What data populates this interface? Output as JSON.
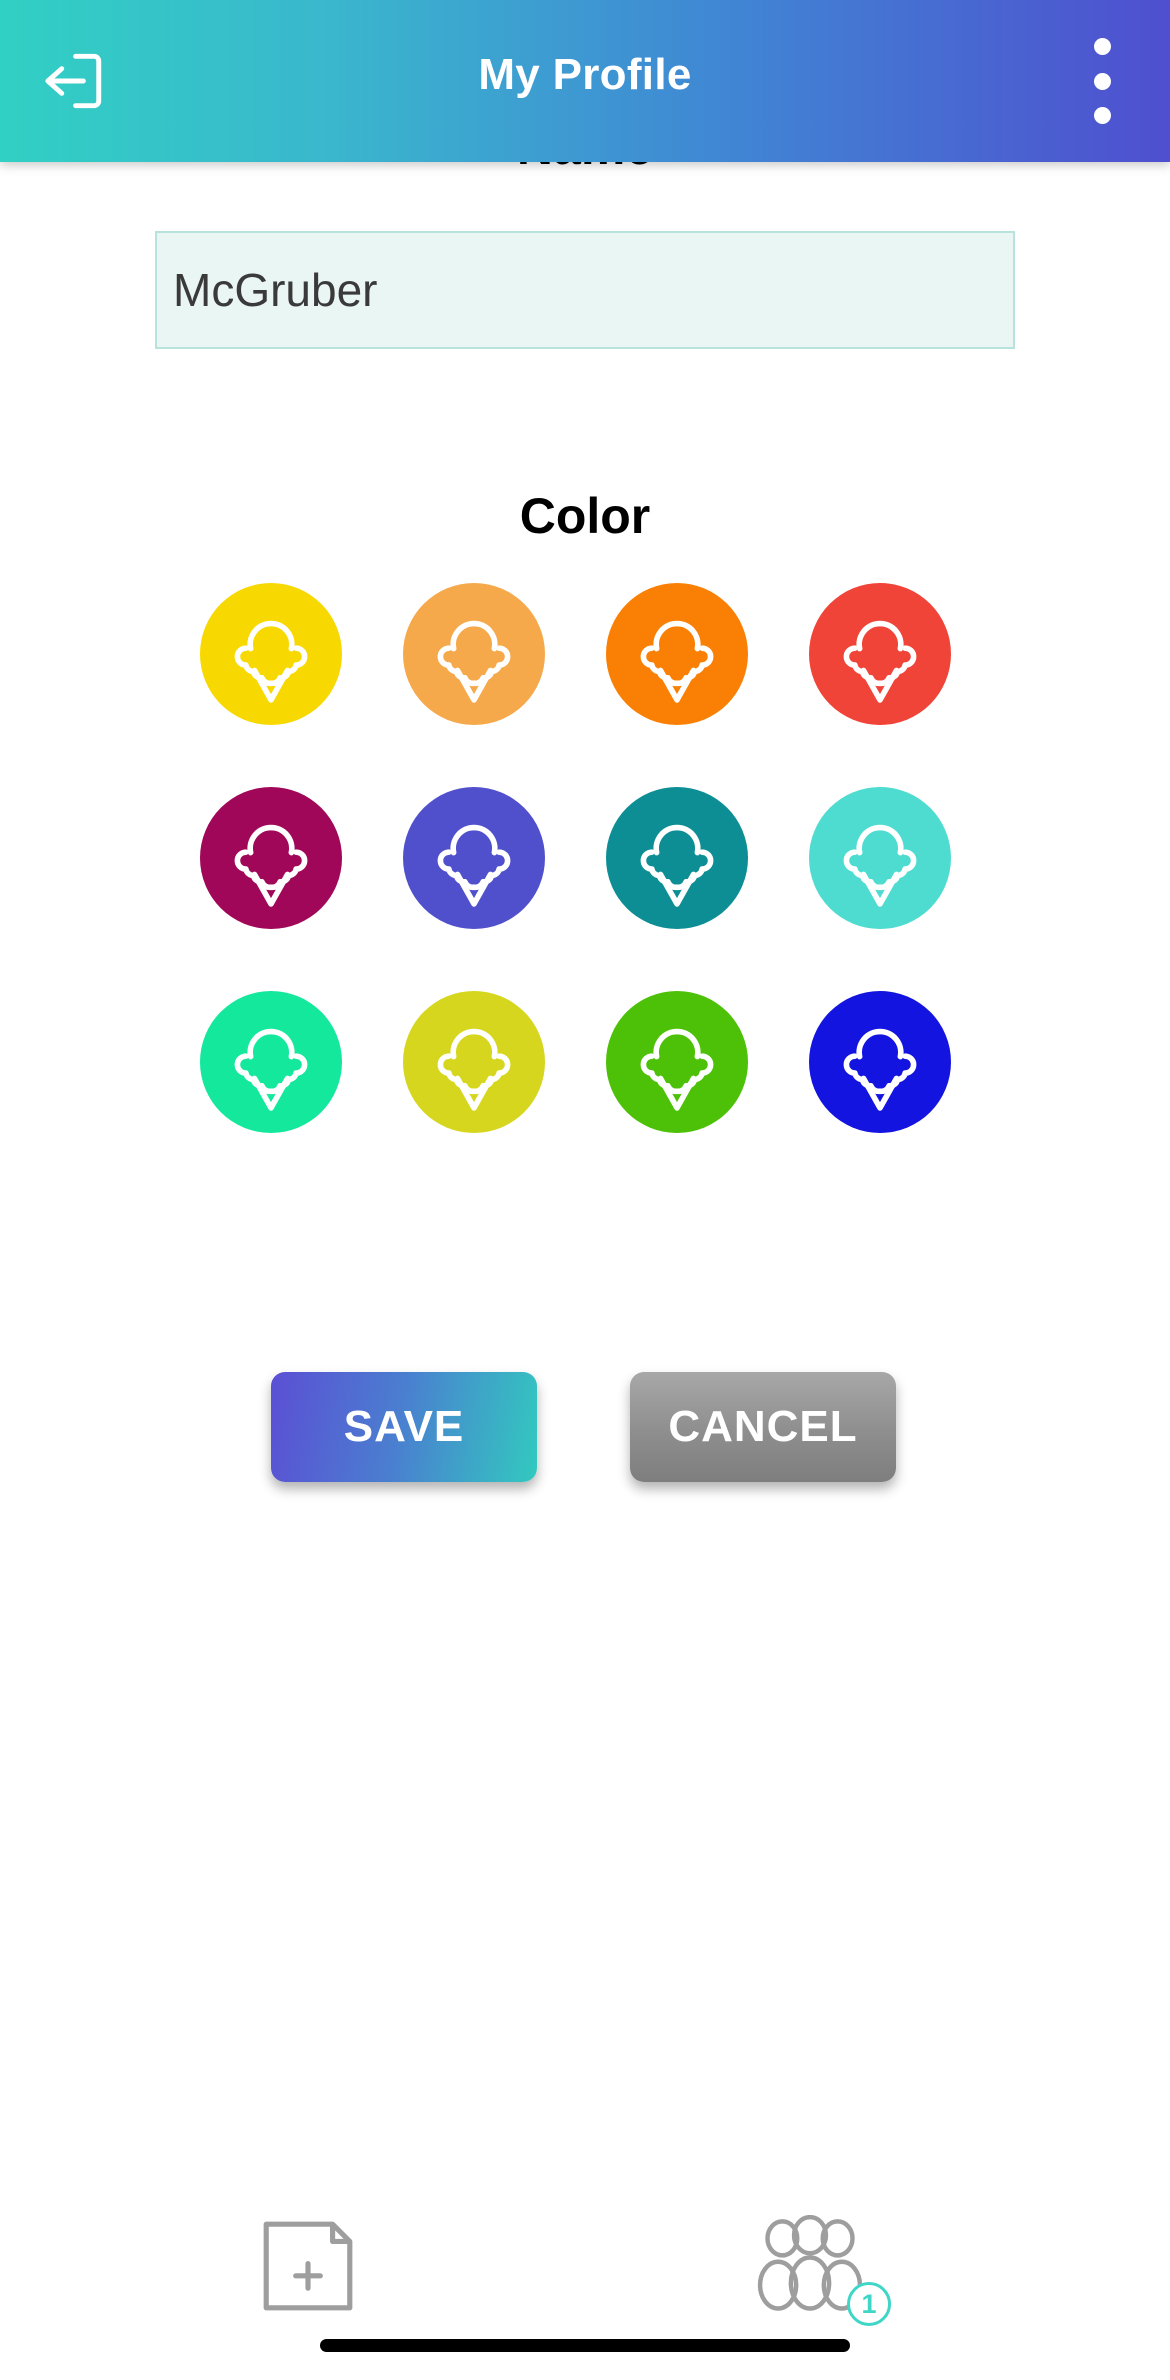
{
  "appbar": {
    "title": "My Profile",
    "back_icon": "exit-arrow-icon",
    "overflow_icon": "overflow-menu-icon",
    "gradient_start": "#31d0c4",
    "gradient_end": "#4f4fcf"
  },
  "form": {
    "name_label": "Name",
    "name_value": "McGruber",
    "name_placeholder": "Name",
    "color_label": "Color"
  },
  "colors": {
    "icon": "ice-cream-cone-icon",
    "swatches": [
      {
        "name": "yellow",
        "hex": "#F7D800"
      },
      {
        "name": "light-orange",
        "hex": "#F5A94B"
      },
      {
        "name": "orange",
        "hex": "#FA8005"
      },
      {
        "name": "red",
        "hex": "#F04438"
      },
      {
        "name": "magenta",
        "hex": "#A00759"
      },
      {
        "name": "indigo",
        "hex": "#5050CC"
      },
      {
        "name": "teal",
        "hex": "#0D8E95"
      },
      {
        "name": "turquoise",
        "hex": "#4FDCD0"
      },
      {
        "name": "spring-green",
        "hex": "#13E89C"
      },
      {
        "name": "citron",
        "hex": "#D6D61E"
      },
      {
        "name": "green",
        "hex": "#4DC107"
      },
      {
        "name": "blue",
        "hex": "#1414E0"
      }
    ]
  },
  "actions": {
    "save_label": "SAVE",
    "cancel_label": "CANCEL"
  },
  "bottom_nav": {
    "add_icon": "add-note-icon",
    "group_icon": "people-group-icon",
    "group_badge": "1"
  }
}
